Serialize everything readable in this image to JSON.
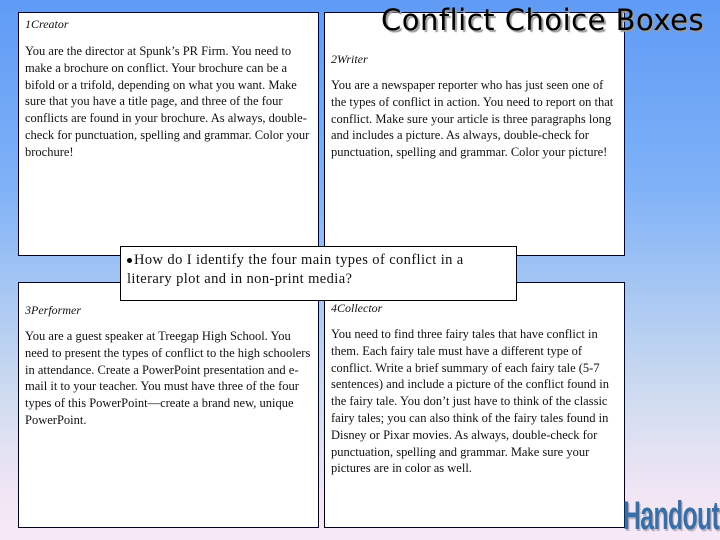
{
  "title": "Conflict Choice Boxes",
  "question": "How do I identify the four main types of conflict in a literary plot and in non-print media?",
  "boxes": [
    {
      "number": "1",
      "role": "Creator",
      "label": "1Creator",
      "description": "You are the director at Spunk’s PR Firm.  You need to make a brochure on conflict.  Your brochure can be a bifold or a trifold, depending on what you want.  Make sure that you have a title page, and three of the four conflicts are found in your brochure.  As always, double-check for punctuation, spelling and grammar.  Color your brochure!"
    },
    {
      "number": "2",
      "role": "Writer",
      "label": "2Writer",
      "description": "You are a newspaper reporter who has just seen one of the types of conflict in action.  You need to report on that conflict.  Make sure your article is three paragraphs long and includes a picture.  As always, double-check for punctuation, spelling and grammar.  Color your picture!"
    },
    {
      "number": "3",
      "role": "Performer",
      "label": "3Performer",
      "description": "You are a guest speaker at Treegap High School.  You need to present the types of conflict to the high schoolers in attendance.  Create a PowerPoint presentation and e-mail it to your teacher.  You must have three of the four types of this PowerPoint—create a brand new, unique PowerPoint."
    },
    {
      "number": "4",
      "role": "Collector",
      "label": "4Collector",
      "description": "You need to find three fairy tales that have conflict in them.  Each fairy tale must have a different type of conflict.  Write a brief summary of each fairy tale (5-7 sentences) and include a picture of the conflict found in the fairy tale.  You don’t just have to think of the classic fairy tales; you can also think of the fairy tales found in Disney or Pixar movies.  As always, double-check for punctuation, spelling and grammar.  Make sure your pictures are in color as well."
    }
  ],
  "footer_label": "Handout",
  "colors": {
    "background_top": "#5f9bf6",
    "background_bottom": "#f7e8f6",
    "handout_text": "#3a6ea6"
  }
}
